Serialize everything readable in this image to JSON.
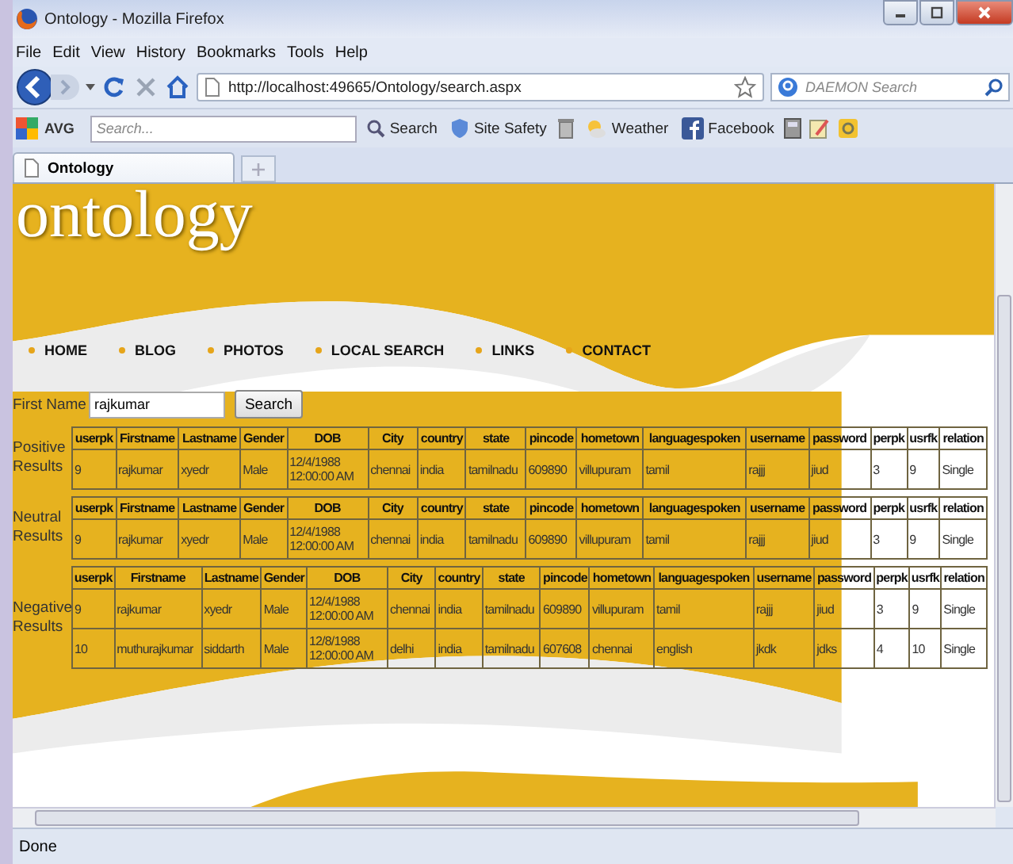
{
  "window": {
    "title": "Ontology - Mozilla Firefox"
  },
  "menu": [
    "File",
    "Edit",
    "View",
    "History",
    "Bookmarks",
    "Tools",
    "Help"
  ],
  "navigation": {
    "address": "http://localhost:49665/Ontology/search.aspx",
    "search_placeholder": "DAEMON Search"
  },
  "avg_toolbar": {
    "brand": "AVG",
    "search_placeholder": "Search...",
    "search_button": "Search",
    "items": [
      "Site Safety",
      "Weather",
      "Facebook"
    ]
  },
  "tabs": [
    {
      "label": "Ontology",
      "selected": true
    }
  ],
  "page": {
    "logo": "ontology",
    "nav": [
      "HOME",
      "BLOG",
      "PHOTOS",
      "LOCAL SEARCH",
      "LINKS",
      "CONTACT"
    ],
    "form": {
      "label": "First Name",
      "value": "rajkumar",
      "button": "Search"
    },
    "result_groups": [
      {
        "label": "Positive Results",
        "columns": [
          "userpk",
          "Firstname",
          "Lastname",
          "Gender",
          "DOB",
          "City",
          "country",
          "state",
          "pincode",
          "hometown",
          "languagespoken",
          "username",
          "password",
          "perpk",
          "usrfk",
          "relation"
        ],
        "rows": [
          [
            "9",
            "rajkumar",
            "xyedr",
            "Male",
            "12/4/1988 12:00:00 AM",
            "chennai",
            "india",
            "tamilnadu",
            "609890",
            "villupuram",
            "tamil",
            "rajjj",
            "jiud",
            "3",
            "9",
            "Single"
          ]
        ]
      },
      {
        "label": "Neutral Results",
        "columns": [
          "userpk",
          "Firstname",
          "Lastname",
          "Gender",
          "DOB",
          "City",
          "country",
          "state",
          "pincode",
          "hometown",
          "languagespoken",
          "username",
          "password",
          "perpk",
          "usrfk",
          "relation"
        ],
        "rows": [
          [
            "9",
            "rajkumar",
            "xyedr",
            "Male",
            "12/4/1988 12:00:00 AM",
            "chennai",
            "india",
            "tamilnadu",
            "609890",
            "villupuram",
            "tamil",
            "rajjj",
            "jiud",
            "3",
            "9",
            "Single"
          ]
        ]
      },
      {
        "label": "Negative Results",
        "columns": [
          "userpk",
          "Firstname",
          "Lastname",
          "Gender",
          "DOB",
          "City",
          "country",
          "state",
          "pincode",
          "hometown",
          "languagespoken",
          "username",
          "password",
          "perpk",
          "usrfk",
          "relation"
        ],
        "rows": [
          [
            "9",
            "rajkumar",
            "xyedr",
            "Male",
            "12/4/1988 12:00:00 AM",
            "chennai",
            "india",
            "tamilnadu",
            "609890",
            "villupuram",
            "tamil",
            "rajjj",
            "jiud",
            "3",
            "9",
            "Single"
          ],
          [
            "10",
            "muthurajkumar",
            "siddarth",
            "Male",
            "12/8/1988 12:00:00 AM",
            "delhi",
            "india",
            "tamilnadu",
            "607608",
            "chennai",
            "english",
            "jkdk",
            "jdks",
            "4",
            "10",
            "Single"
          ]
        ]
      }
    ]
  },
  "status_bar": "Done"
}
